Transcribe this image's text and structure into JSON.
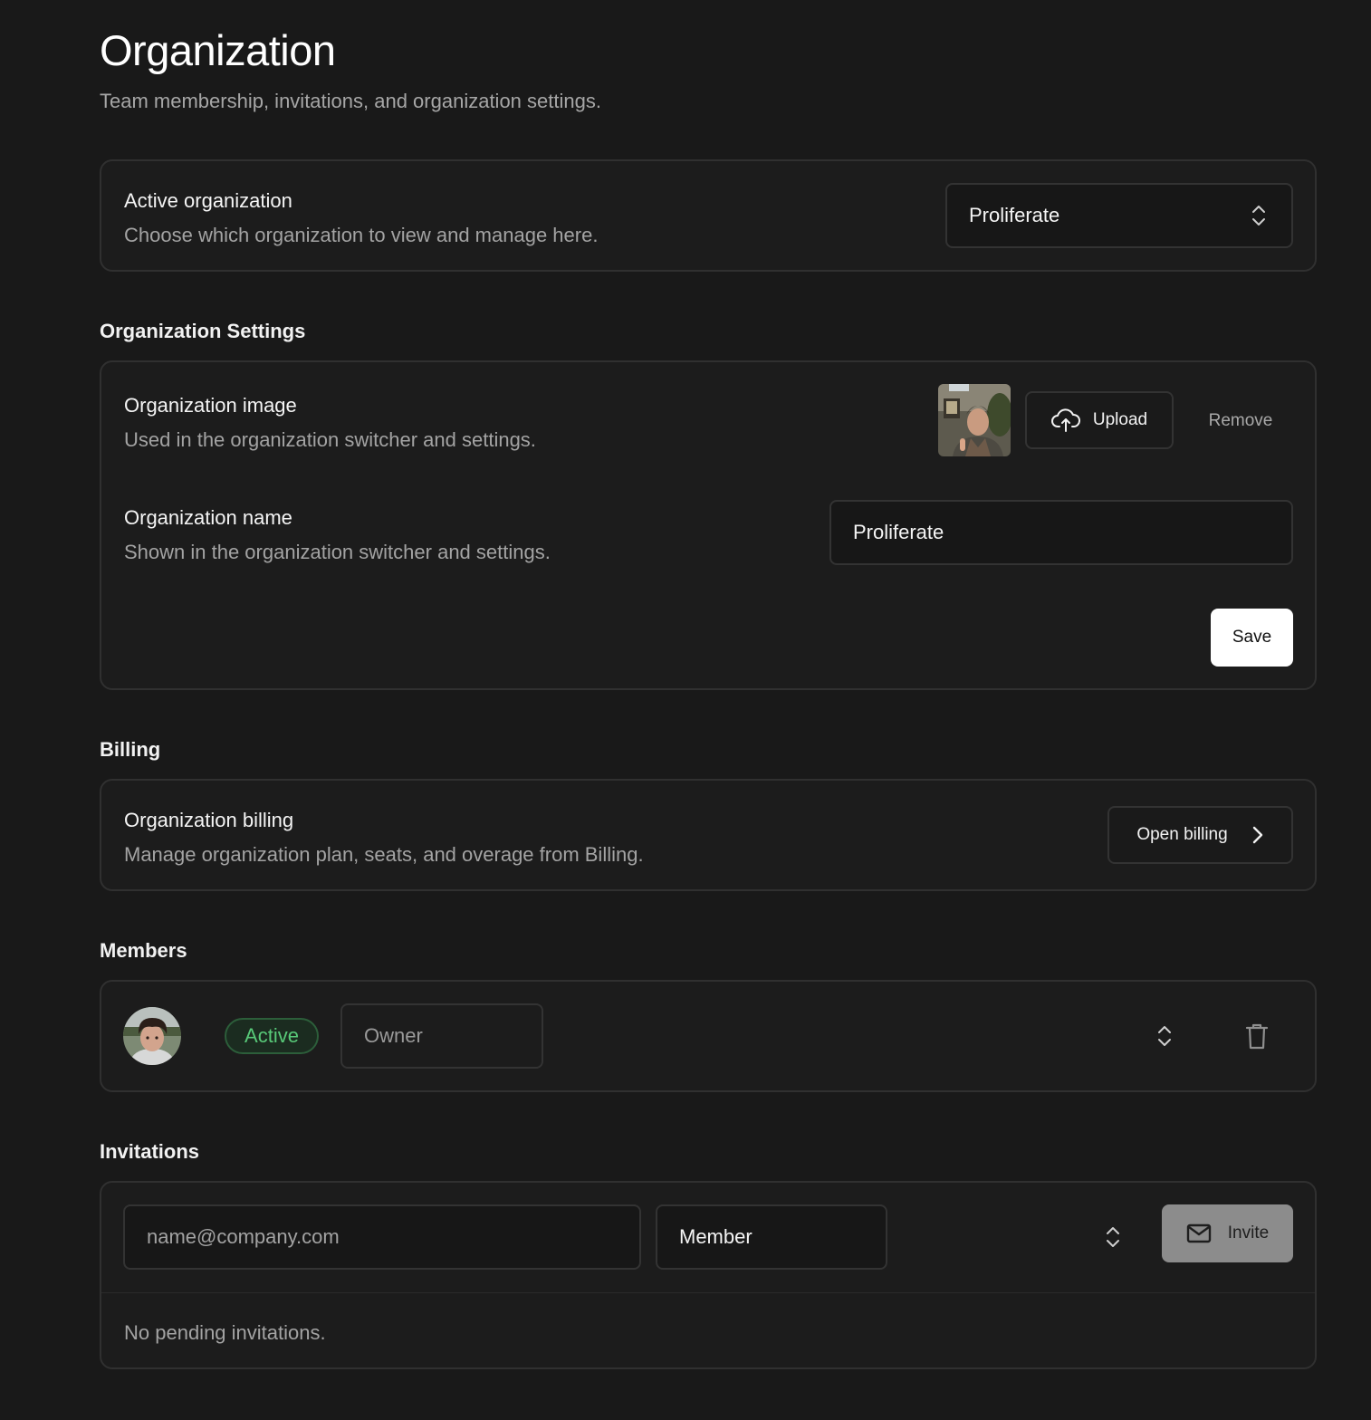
{
  "header": {
    "title": "Organization",
    "subtitle": "Team membership, invitations, and organization settings."
  },
  "active_org": {
    "title": "Active organization",
    "description": "Choose which organization to view and manage here.",
    "selected": "Proliferate"
  },
  "settings": {
    "section_label": "Organization Settings",
    "image_title": "Organization image",
    "image_description": "Used in the organization switcher and settings.",
    "upload_label": "Upload",
    "remove_label": "Remove",
    "name_title": "Organization name",
    "name_description": "Shown in the organization switcher and settings.",
    "name_value": "Proliferate",
    "save_label": "Save"
  },
  "billing": {
    "section_label": "Billing",
    "title": "Organization billing",
    "description": "Manage organization plan, seats, and overage from Billing.",
    "open_label": "Open billing"
  },
  "members": {
    "section_label": "Members",
    "rows": [
      {
        "status": "Active",
        "role": "Owner"
      }
    ]
  },
  "invitations": {
    "section_label": "Invitations",
    "email_placeholder": "name@company.com",
    "role_selected": "Member",
    "invite_label": "Invite",
    "empty_text": "No pending invitations."
  },
  "colors": {
    "background": "#191919",
    "card": "#1c1c1c",
    "border": "#303030",
    "active_green": "#58c978",
    "invite_button": "#8c8c8c"
  },
  "icons": [
    "chevrons-up-down-icon",
    "cloud-upload-icon",
    "chevron-right-icon",
    "trash-icon",
    "mail-icon"
  ]
}
